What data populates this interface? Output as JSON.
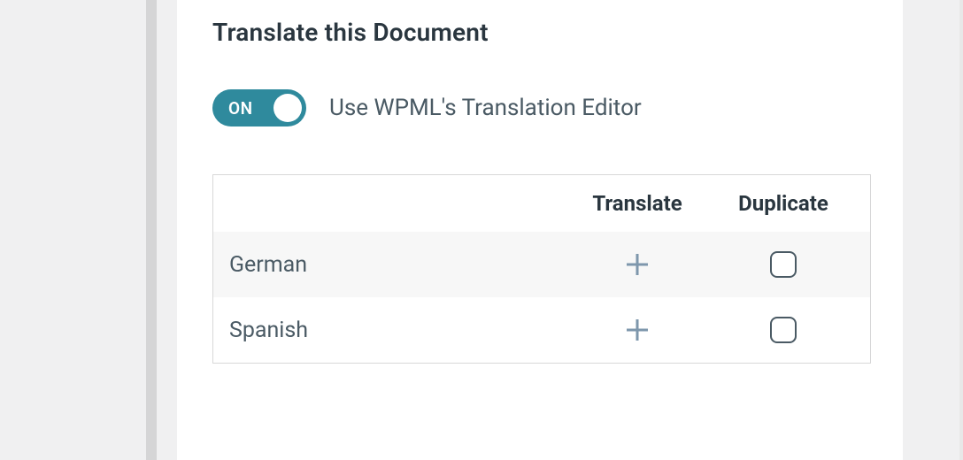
{
  "panel": {
    "title": "Translate this Document"
  },
  "toggle": {
    "state_label": "ON",
    "description": "Use WPML's Translation Editor"
  },
  "table": {
    "headers": {
      "translate": "Translate",
      "duplicate": "Duplicate"
    },
    "rows": [
      {
        "language": "German"
      },
      {
        "language": "Spanish"
      }
    ]
  }
}
